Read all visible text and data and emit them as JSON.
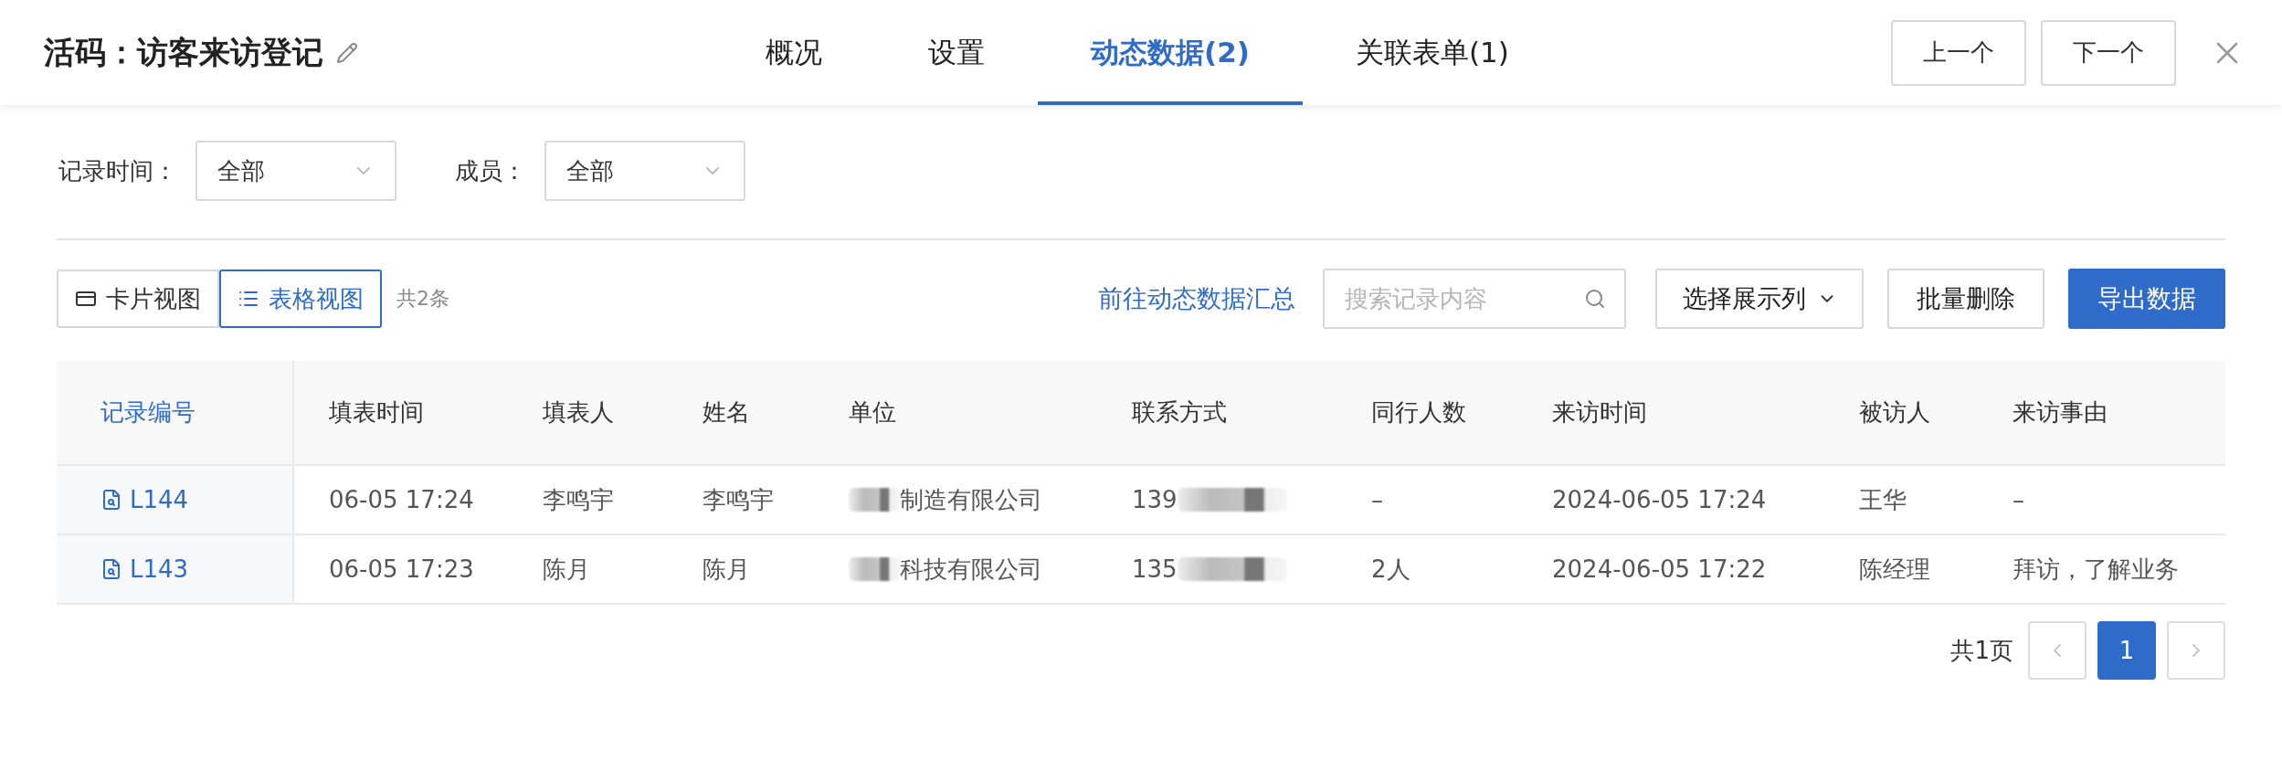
{
  "header": {
    "title": "活码：访客来访登记",
    "tabs": [
      {
        "label": "概况",
        "selected": false
      },
      {
        "label": "设置",
        "selected": false
      },
      {
        "label": "动态数据(2)",
        "selected": true
      },
      {
        "label": "关联表单(1)",
        "selected": false
      }
    ],
    "buttons": [
      "上一个",
      "下一个"
    ]
  },
  "filters": [
    {
      "label": "记录时间：",
      "value": "全部"
    },
    {
      "label": "成员：",
      "value": "全部"
    }
  ],
  "toolbar": {
    "views": [
      {
        "label": "卡片视图",
        "kind": "card",
        "selected": false
      },
      {
        "label": "表格视图",
        "kind": "table",
        "selected": true
      }
    ],
    "count": "共2条",
    "link": "前往动态数据汇总",
    "search": {
      "placeholder": "搜索记录内容"
    },
    "column_select": "选择展示列",
    "buttons": [
      {
        "label": "批量删除",
        "kind": "default"
      },
      {
        "label": "导出数据",
        "kind": "primary"
      }
    ]
  },
  "table": {
    "columns": [
      "记录编号",
      "填表时间",
      "填表人",
      "姓名",
      "单位",
      "联系方式",
      "同行人数",
      "来访时间",
      "被访人",
      "来访事由"
    ],
    "rows": [
      {
        "cells": [
          {
            "text": "L144"
          },
          {
            "text": "06-05 17:24"
          },
          {
            "text": "李鸣宇"
          },
          {
            "text": "李鸣宇"
          },
          {
            "text": "制造有限公司",
            "blur_before": true
          },
          {
            "text": "139",
            "blur_after": true
          },
          {
            "text": "–"
          },
          {
            "text": "2024-06-05 17:24"
          },
          {
            "text": "王华"
          },
          {
            "text": "–"
          }
        ]
      },
      {
        "cells": [
          {
            "text": "L143"
          },
          {
            "text": "06-05 17:23"
          },
          {
            "text": "陈月"
          },
          {
            "text": "陈月"
          },
          {
            "text": "科技有限公司",
            "blur_before": true
          },
          {
            "text": "135",
            "blur_after": true
          },
          {
            "text": "2人"
          },
          {
            "text": "2024-06-05 17:22"
          },
          {
            "text": "陈经理"
          },
          {
            "text": "拜访，了解业务"
          }
        ]
      }
    ]
  },
  "pagination": {
    "total": "共1页",
    "prev": {
      "disabled": true
    },
    "pages": [
      {
        "label": "1",
        "selected": true
      }
    ],
    "next": {
      "disabled": true
    }
  }
}
